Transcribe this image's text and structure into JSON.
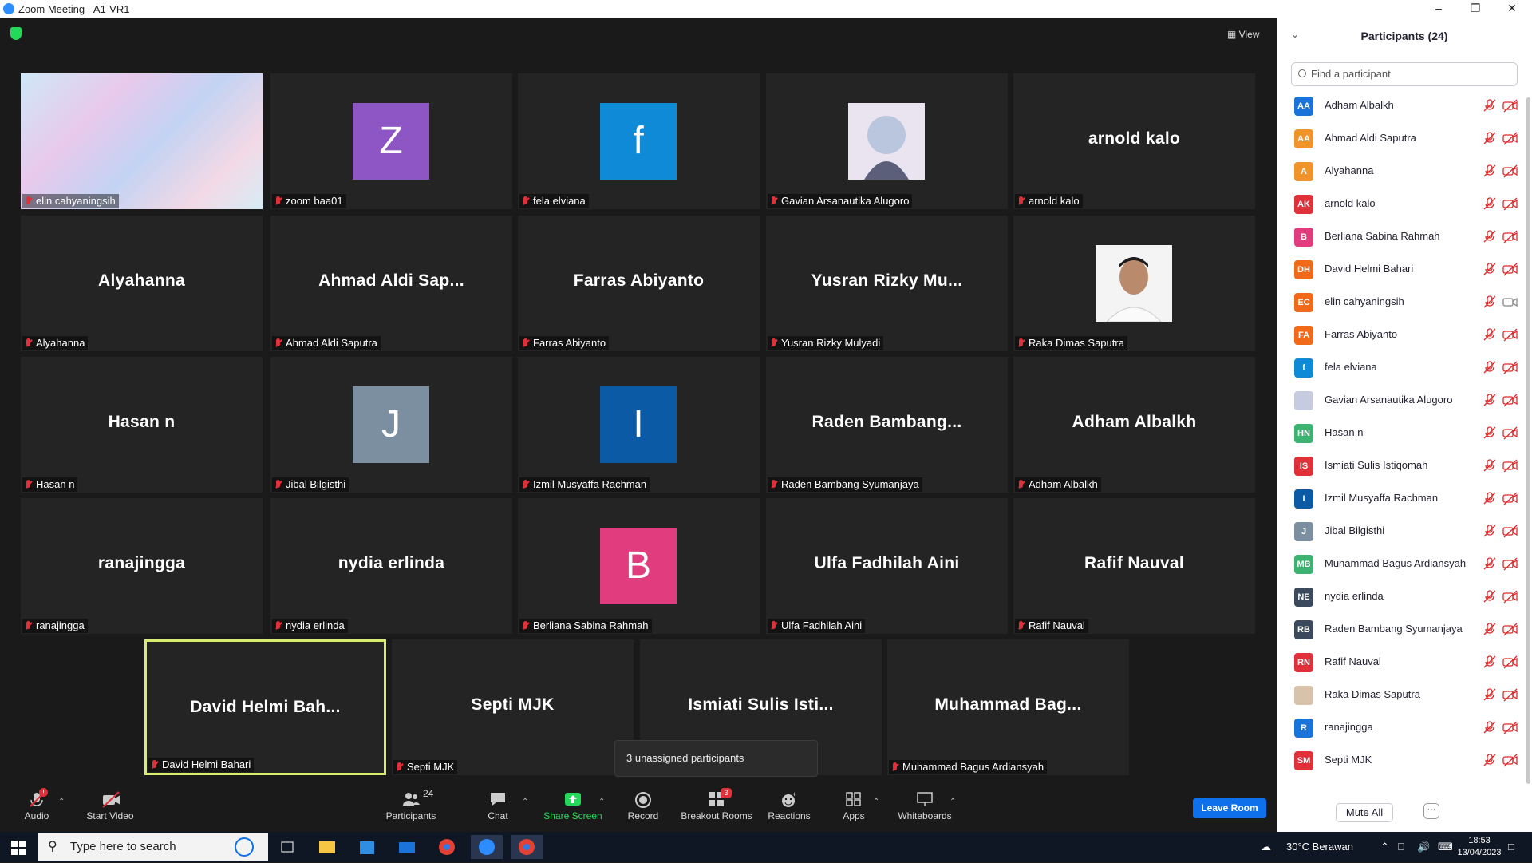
{
  "window": {
    "title": "Zoom Meeting - A1-VR1"
  },
  "view_label": "View",
  "tiles": [
    {
      "big": "",
      "label": "elin cahyaningsih",
      "type": "video"
    },
    {
      "big": "Z",
      "label": "zoom baa01",
      "type": "avatar",
      "color": "#8e55c4"
    },
    {
      "big": "f",
      "label": "fela elviana",
      "type": "avatar",
      "color": "#0e8ad6"
    },
    {
      "big": "",
      "label": "Gavian Arsanautika Alugoro",
      "type": "anime"
    },
    {
      "big": "arnold kalo",
      "label": "arnold kalo",
      "type": "name"
    },
    {
      "big": "Alyahanna",
      "label": "Alyahanna",
      "type": "name"
    },
    {
      "big": "Ahmad Aldi Sap...",
      "label": "Ahmad Aldi Saputra",
      "type": "name"
    },
    {
      "big": "Farras Abiyanto",
      "label": "Farras Abiyanto",
      "type": "name"
    },
    {
      "big": "Yusran Rizky Mu...",
      "label": "Yusran Rizky Mulyadi",
      "type": "name"
    },
    {
      "big": "",
      "label": "Raka Dimas Saputra",
      "type": "photo"
    },
    {
      "big": "Hasan n",
      "label": "Hasan n",
      "type": "name"
    },
    {
      "big": "J",
      "label": "Jibal Bilgisthi",
      "type": "avatar",
      "color": "#7b8fa0"
    },
    {
      "big": "I",
      "label": "Izmil Musyaffa Rachman",
      "type": "avatar",
      "color": "#0b5aa6"
    },
    {
      "big": "Raden Bambang...",
      "label": "Raden Bambang Syumanjaya",
      "type": "name"
    },
    {
      "big": "Adham Albalkh",
      "label": "Adham Albalkh",
      "type": "name"
    },
    {
      "big": "ranajingga",
      "label": "ranajingga",
      "type": "name"
    },
    {
      "big": "nydia erlinda",
      "label": "nydia erlinda",
      "type": "name"
    },
    {
      "big": "B",
      "label": "Berliana Sabina Rahmah",
      "type": "avatar",
      "color": "#e03c7e"
    },
    {
      "big": "Ulfa Fadhilah Aini",
      "label": "Ulfa Fadhilah Aini",
      "type": "name"
    },
    {
      "big": "Rafif Nauval",
      "label": "Rafif Nauval",
      "type": "name"
    },
    {
      "big": "David Helmi Bah...",
      "label": "David Helmi Bahari",
      "type": "name",
      "active": true
    },
    {
      "big": "Septi MJK",
      "label": "Septi MJK",
      "type": "name"
    },
    {
      "big": "Ismiati Sulis Isti...",
      "label": "",
      "type": "name"
    },
    {
      "big": "Muhammad Bag...",
      "label": "Muhammad Bagus Ardiansyah",
      "type": "name"
    }
  ],
  "tooltip": "3 unassigned participants",
  "toolbar": {
    "audio": "Audio",
    "audio_badge": "!",
    "start_video": "Start Video",
    "participants": "Participants",
    "participants_count": "24",
    "chat": "Chat",
    "share_screen": "Share Screen",
    "record": "Record",
    "breakout_rooms": "Breakout Rooms",
    "breakout_badge": "3",
    "reactions": "Reactions",
    "apps": "Apps",
    "whiteboards": "Whiteboards",
    "leave_room": "Leave Room"
  },
  "panel": {
    "title": "Participants (24)",
    "search_placeholder": "Find a participant",
    "mute_all": "Mute All",
    "more": "···",
    "participants": [
      {
        "initials": "AA",
        "name": "Adham Albalkh",
        "color": "#1a73d9"
      },
      {
        "initials": "AA",
        "name": "Ahmad Aldi Saputra",
        "color": "#f0932b"
      },
      {
        "initials": "A",
        "name": "Alyahanna",
        "color": "#f0932b"
      },
      {
        "initials": "AK",
        "name": "arnold kalo",
        "color": "#e0313b"
      },
      {
        "initials": "B",
        "name": "Berliana Sabina Rahmah",
        "color": "#e03c7e"
      },
      {
        "initials": "DH",
        "name": "David Helmi Bahari",
        "color": "#f06a1a"
      },
      {
        "initials": "EC",
        "name": "elin cahyaningsih",
        "color": "#f06a1a"
      },
      {
        "initials": "FA",
        "name": "Farras Abiyanto",
        "color": "#f06a1a"
      },
      {
        "initials": "f",
        "name": "fela elviana",
        "color": "#0e8ad6"
      },
      {
        "initials": "",
        "name": "Gavian Arsanautika Alugoro",
        "color": "#c7cbe0"
      },
      {
        "initials": "HN",
        "name": "Hasan n",
        "color": "#3cb371"
      },
      {
        "initials": "IS",
        "name": "Ismiati Sulis Istiqomah",
        "color": "#e0313b"
      },
      {
        "initials": "I",
        "name": "Izmil Musyaffa Rachman",
        "color": "#0b5aa6"
      },
      {
        "initials": "J",
        "name": "Jibal Bilgisthi",
        "color": "#7b8fa0"
      },
      {
        "initials": "MB",
        "name": "Muhammad Bagus Ardiansyah",
        "color": "#3cb371"
      },
      {
        "initials": "NE",
        "name": "nydia erlinda",
        "color": "#3a4a5c"
      },
      {
        "initials": "RB",
        "name": "Raden Bambang Syumanjaya",
        "color": "#3a4a5c"
      },
      {
        "initials": "RN",
        "name": "Rafif Nauval",
        "color": "#e0313b"
      },
      {
        "initials": "",
        "name": "Raka Dimas Saputra",
        "color": "#d8c2aa"
      },
      {
        "initials": "R",
        "name": "ranajingga",
        "color": "#1a73d9"
      },
      {
        "initials": "SM",
        "name": "Septi MJK",
        "color": "#e0313b"
      }
    ]
  },
  "taskbar": {
    "search_placeholder": "Type here to search",
    "weather": "30°C  Berawan",
    "time": "18:53",
    "date": "13/04/2023"
  }
}
